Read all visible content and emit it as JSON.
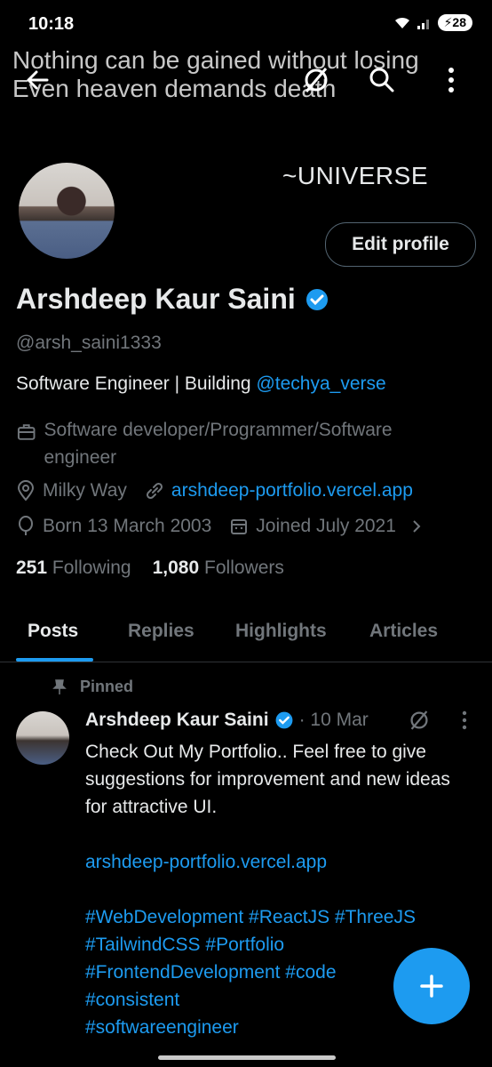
{
  "status": {
    "time": "10:18",
    "battery": "28",
    "icons": [
      "wifi-icon",
      "signal-icon",
      "battery-charging-icon"
    ]
  },
  "header": {
    "banner_text": "Nothing can be gained without losing\nEven heaven demands death",
    "universe_text": "~UNIVERSE",
    "icons": [
      "back-arrow-icon",
      "grok-icon",
      "search-icon",
      "more-vertical-icon"
    ]
  },
  "profile": {
    "edit_button": "Edit profile",
    "name": "Arshdeep Kaur Saini",
    "handle": "@arsh_saini1333",
    "bio_prefix": "Software Engineer | Building ",
    "bio_mention": "@techya_verse",
    "profession": "Software developer/Programmer/Software engineer",
    "location": "Milky Way",
    "website": "arshdeep-portfolio.vercel.app",
    "birthday": "Born 13 March 2003",
    "joined": "Joined July 2021",
    "following_count": "251",
    "following_label": "Following",
    "followers_count": "1,080",
    "followers_label": "Followers"
  },
  "tabs": [
    "Posts",
    "Replies",
    "Highlights",
    "Articles"
  ],
  "post": {
    "pinned_label": "Pinned",
    "author": "Arshdeep Kaur Saini",
    "date": "· 10 Mar",
    "text": "Check Out My Portfolio.. Feel free to give suggestions for improvement and new ideas for attractive UI.",
    "link": "arshdeep-portfolio.vercel.app",
    "hashtags_line1": "#WebDevelopment #ReactJS #ThreeJS",
    "hashtags_line2": "#TailwindCSS #Portfolio",
    "hashtags_line3": "#FrontendDevelopment #code",
    "hashtags_line4": "#consistent",
    "hashtags_line5": "#softwareengineer"
  },
  "colors": {
    "accent": "#1d9bf0",
    "background": "#000000",
    "muted": "#71767b"
  }
}
